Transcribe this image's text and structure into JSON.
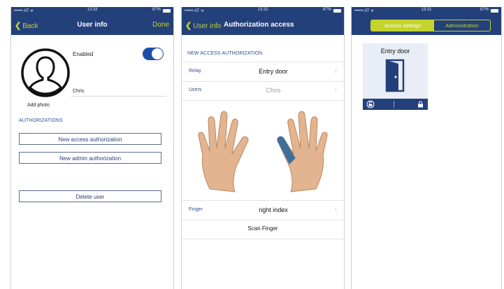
{
  "screen1": {
    "status": {
      "carrier": "•••••• AT ᯤ",
      "time": "13:33",
      "battery": "87%"
    },
    "nav": {
      "back": "Back",
      "title": "User info",
      "done": "Done"
    },
    "enabled_label": "Enabled",
    "enabled_on": true,
    "user_name": "Chris",
    "add_photo": "Add photo",
    "section_title": "AUTHORIZATIONS",
    "buttons": {
      "new_access": "New access authorization",
      "new_admin": "New admin authorization",
      "delete_user": "Delete user"
    }
  },
  "screen2": {
    "status": {
      "carrier": "•••••• AT ᯤ",
      "time": "13:32",
      "battery": "87%"
    },
    "nav": {
      "back": "User info",
      "title": "Authorization access"
    },
    "section_title": "NEW ACCESS AUTHORIZATION",
    "rows": [
      {
        "label": "Relay",
        "value": "Entry door"
      },
      {
        "label": "Users",
        "value": "Chris"
      }
    ],
    "finger_row": {
      "label": "Finger",
      "value": "right index"
    },
    "scan_button": "Scan Finger"
  },
  "screen3": {
    "status": {
      "carrier": "•••••• AT ᯤ",
      "time": "13:31",
      "battery": "87%"
    },
    "tabs": {
      "active": "Access settings",
      "inactive": "Administration"
    },
    "tile_title": "Entry door"
  },
  "colors": {
    "nav_blue": "#23407a",
    "accent_green": "#c4d42a",
    "link_blue": "#2a4f96",
    "finger_highlight": "#3f6f9a"
  },
  "icons": [
    "person-avatar-icon",
    "chevron-left-icon",
    "chevron-right-icon",
    "open-door-icon",
    "fingerprint-icon",
    "lock-icon",
    "hand-icon"
  ]
}
